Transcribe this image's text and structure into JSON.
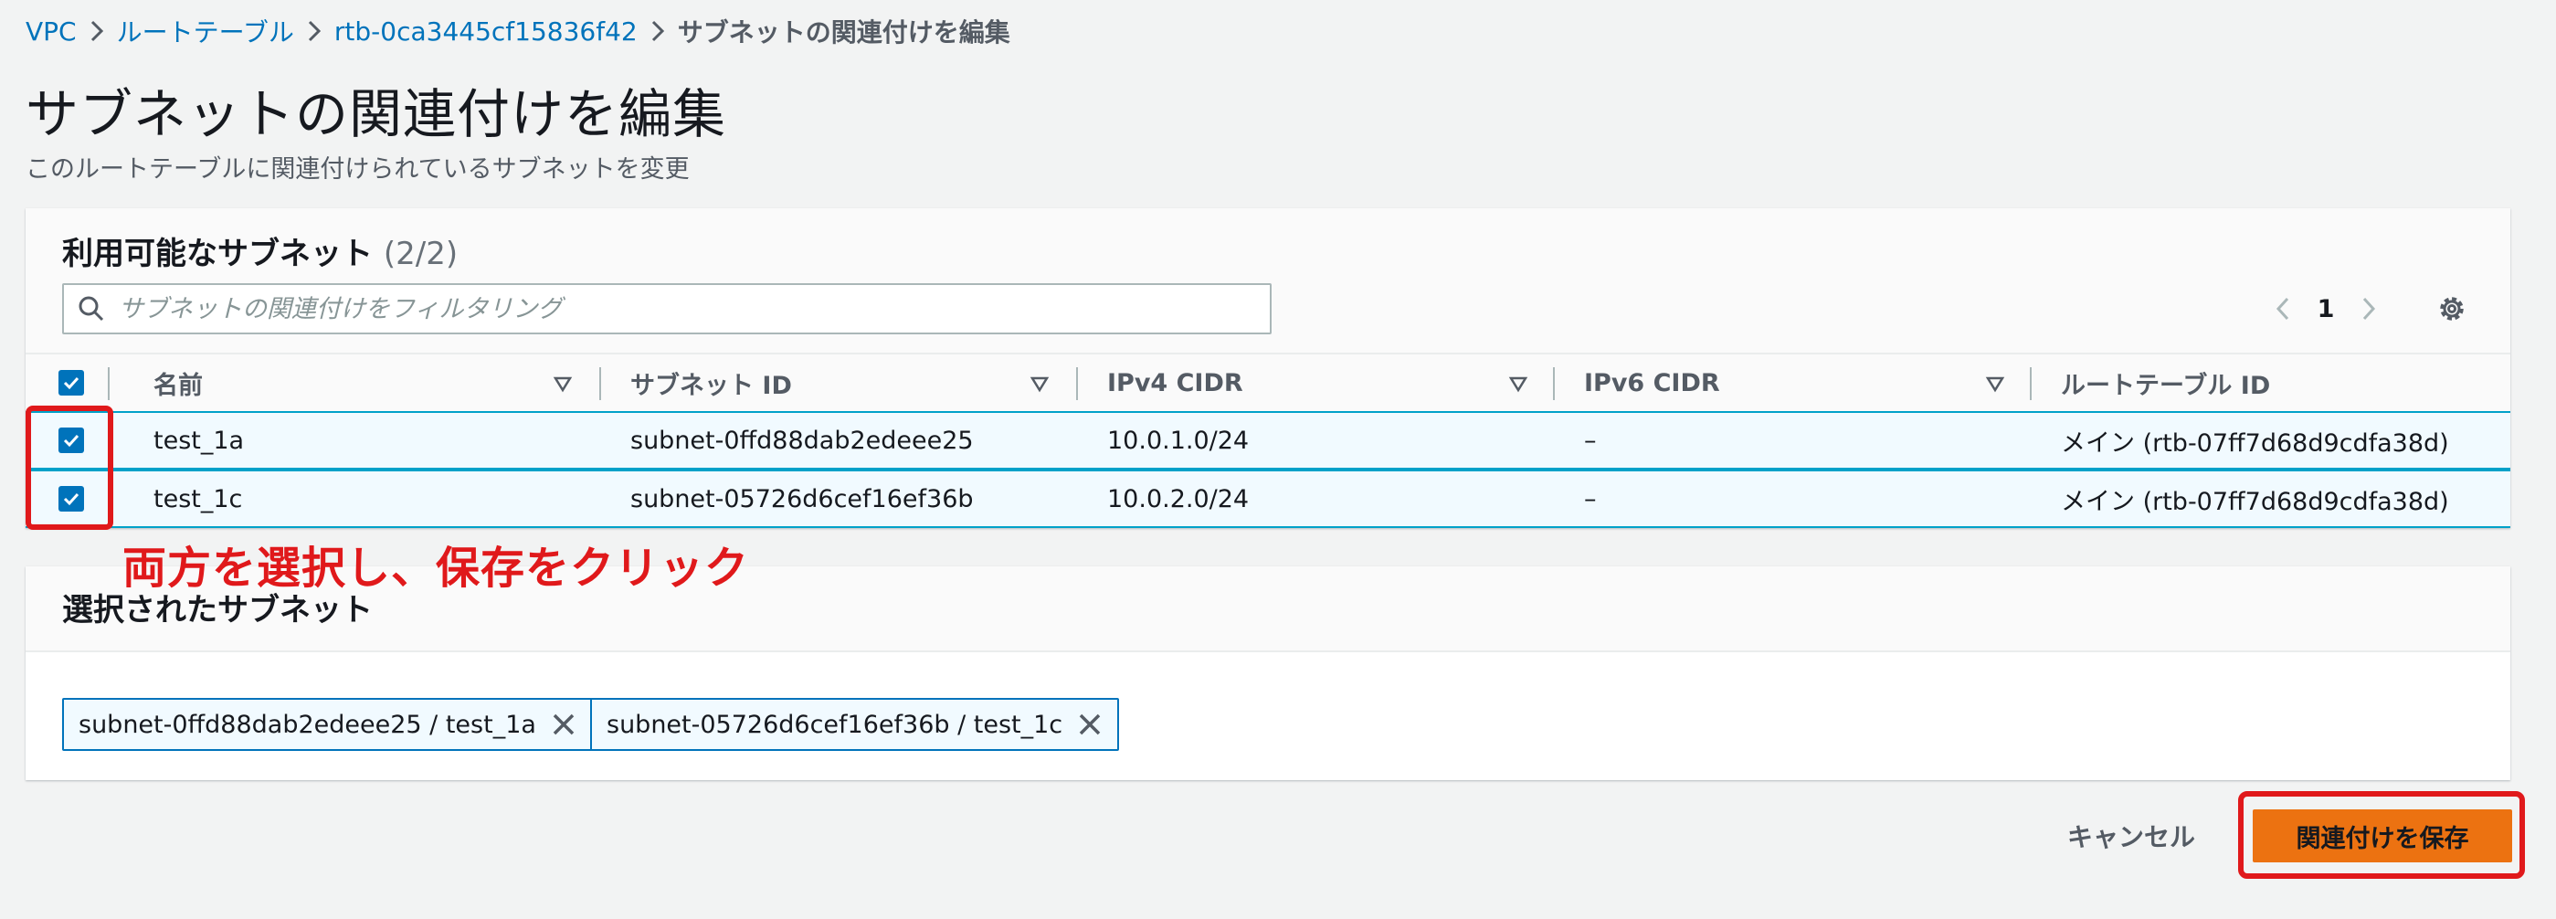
{
  "breadcrumb": {
    "items": [
      "VPC",
      "ルートテーブル",
      "rtb-0ca3445cf15836f42"
    ],
    "current": "サブネットの関連付けを編集"
  },
  "page": {
    "title": "サブネットの関連付けを編集",
    "subtitle": "このルートテーブルに関連付けられているサブネットを変更"
  },
  "available": {
    "title": "利用可能なサブネット",
    "count": "(2/2)",
    "filter_placeholder": "サブネットの関連付けをフィルタリング",
    "page": "1",
    "columns": [
      "名前",
      "サブネット ID",
      "IPv4 CIDR",
      "IPv6 CIDR",
      "ルートテーブル ID"
    ],
    "rows": [
      {
        "name": "test_1a",
        "subnet_id": "subnet-0ffd88dab2edeee25",
        "ipv4": "10.0.1.0/24",
        "ipv6": "–",
        "route_table": "メイン (rtb-07ff7d68d9cdfa38d)",
        "checked": true
      },
      {
        "name": "test_1c",
        "subnet_id": "subnet-05726d6cef16ef36b",
        "ipv4": "10.0.2.0/24",
        "ipv6": "–",
        "route_table": "メイン (rtb-07ff7d68d9cdfa38d)",
        "checked": true
      }
    ]
  },
  "annotation": {
    "text": "両方を選択し、保存をクリック",
    "color": "#e0191b"
  },
  "selected": {
    "title": "選択されたサブネット",
    "tokens": [
      "subnet-0ffd88dab2edeee25 / test_1a",
      "subnet-05726d6cef16ef36b / test_1c"
    ]
  },
  "actions": {
    "cancel": "キャンセル",
    "save": "関連付けを保存"
  },
  "colors": {
    "link": "#0073bb",
    "primary": "#ec7211",
    "selected_row": "#f1faff"
  }
}
